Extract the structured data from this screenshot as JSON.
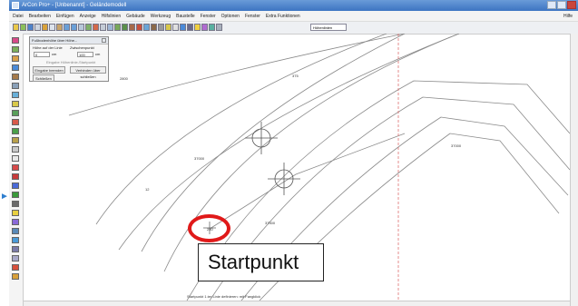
{
  "window": {
    "title": "ArCon Pro+ - [Unbenannt] - Geländemodell"
  },
  "menu": {
    "items": [
      "Datei",
      "Bearbeiten",
      "Einfügen",
      "Anzeige",
      "Hilfslinien",
      "Gebäude",
      "Werkzeug",
      "Baustelle",
      "Fenster",
      "Optionen",
      "Fenster",
      "Extra Funktionen"
    ],
    "right": "Hilfe"
  },
  "toolbar": {
    "combo_value": "Höhenlinien"
  },
  "panel": {
    "title": "Fußbodenhöhe über Höhe...",
    "option_left": "Höhe auf der Linie",
    "option_right": "Zwischenpunkt",
    "value_left": "0",
    "unit_left": "cm",
    "value_right": "100",
    "unit_right": "cm",
    "option_middle": "Eingabe Höhenlinie-Startpunkt",
    "button_left": "Eingabe beenden",
    "button_right": "Verbinden über schließen",
    "button_bottom": "Schließen"
  },
  "contour_labels": {
    "l1": "2800",
    "l2": "375",
    "l3": "37000",
    "l4": "12",
    "l5": "37500",
    "l6": "280",
    "l7": "37000"
  },
  "status": {
    "text": "Startpunkt 1.ter Linie definieren: mit Fangklick"
  },
  "callout": {
    "label": "Startpunkt"
  }
}
